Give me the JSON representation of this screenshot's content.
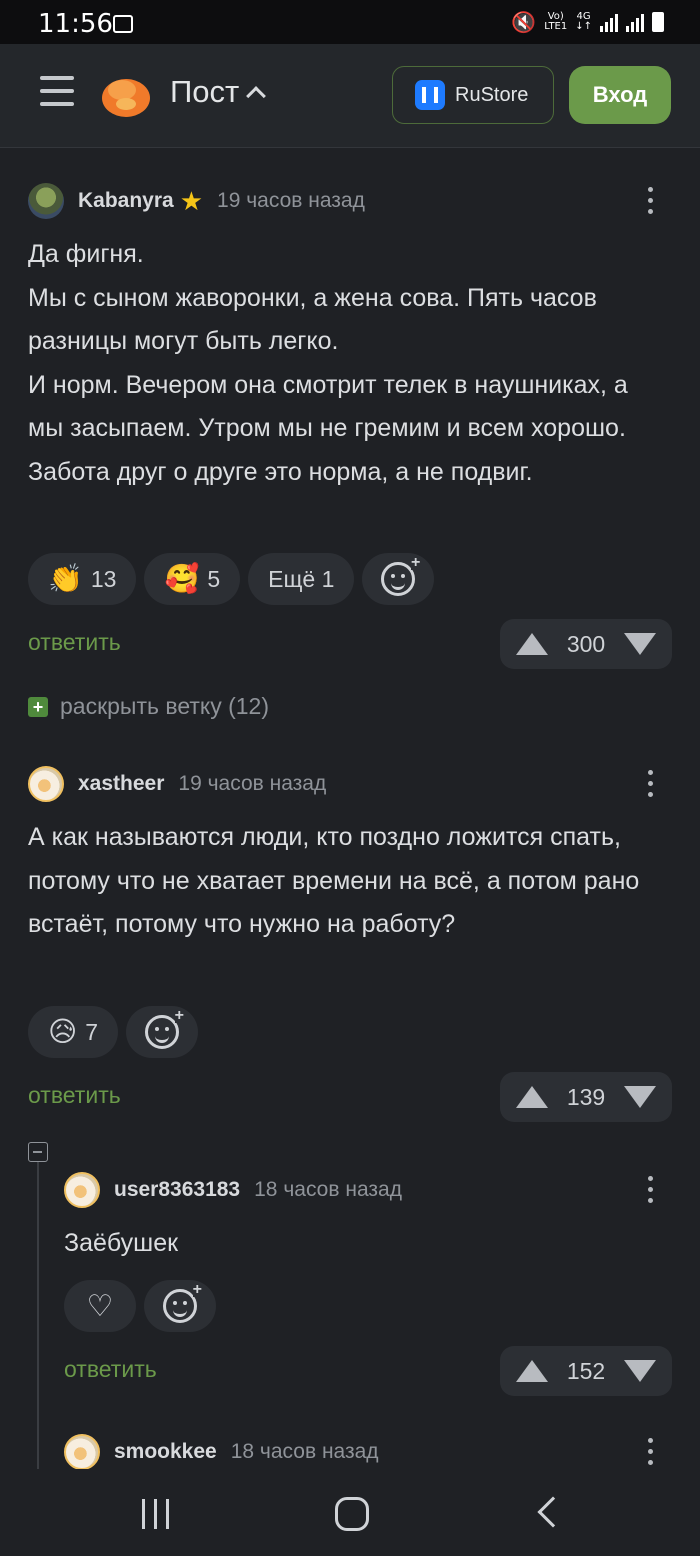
{
  "status_bar": {
    "time": "11:56",
    "network": [
      "Vo)",
      "LTE1"
    ],
    "net_type": "4G"
  },
  "header": {
    "title": "Пост",
    "rustore_label": "RuStore",
    "login_label": "Вход"
  },
  "comments": [
    {
      "username": "Kabanyra",
      "time": "19 часов назад",
      "text": "Да фигня.\nМы с сыном жаворонки, а жена сова. Пять часов разницы могут быть легко.\nИ норм. Вечером она смотрит телек в наушниках, а мы засыпаем. Утром мы не гремим и всем хорошо.\nЗабота друг о друге это норма, а не подвиг.",
      "reactions": [
        {
          "emoji": "👏",
          "count": "13"
        },
        {
          "emoji": "🥰",
          "count": "5"
        }
      ],
      "more_label": "Ещё 1",
      "reply_label": "ответить",
      "votes": "300"
    },
    {
      "username": "xastheer",
      "time": "19 часов назад",
      "text": "А как называются люди, кто поздно ложится спать, потому что не хватает времени на всё, а потом рано встаёт, потому что нужно на работу?",
      "reactions": [
        {
          "emoji": "😥",
          "count": "7"
        }
      ],
      "reply_label": "ответить",
      "votes": "139"
    },
    {
      "username": "user8363183",
      "time": "18 часов назад",
      "text": "Заёбушек",
      "reply_label": "ответить",
      "votes": "152"
    },
    {
      "username": "smookkee",
      "time": "18 часов назад"
    }
  ],
  "expand_thread": {
    "label": "раскрыть ветку (12)"
  }
}
